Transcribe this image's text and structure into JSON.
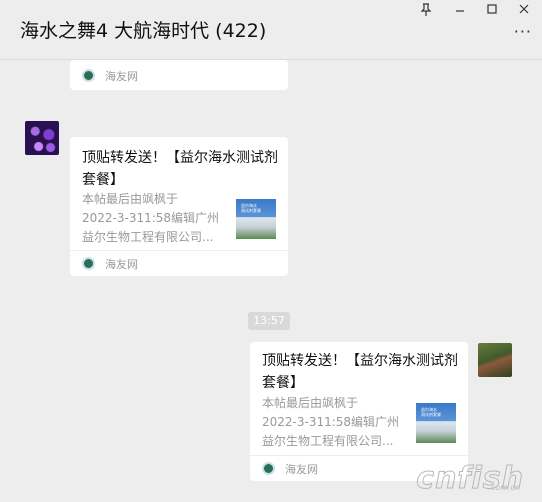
{
  "header": {
    "title": "海水之舞4 大航海时代 (422)",
    "pin_icon": "pin-icon",
    "minimize_icon": "minimize-icon",
    "maximize_icon": "maximize-icon",
    "close_icon": "close-icon",
    "more_icon": "more-options-icon"
  },
  "messages": [
    {
      "source": "海友网"
    },
    {
      "title_line1": "顶贴转发送！【益尔海水测试剂",
      "title_line2": "套餐】",
      "desc_line1": "本帖最后由飒枫于",
      "desc_line2": "2022-3-311:58编辑广州",
      "desc_line3": "益尔生物工程有限公司...",
      "source": "海友网"
    },
    {
      "title_line1": "顶贴转发送！【益尔海水测试剂",
      "title_line2": "套餐】",
      "desc_line1": "本帖最后由飒枫于",
      "desc_line2": "2022-3-311:58编辑广州",
      "desc_line3": "益尔生物工程有限公司...",
      "source": "海友网"
    }
  ],
  "timestamp": "13:57",
  "thumb_text": {
    "line1": "益尔海水",
    "line2": "测试剂套餐"
  },
  "watermark": {
    "main": "cnfish",
    "sub": ".com.cn"
  }
}
